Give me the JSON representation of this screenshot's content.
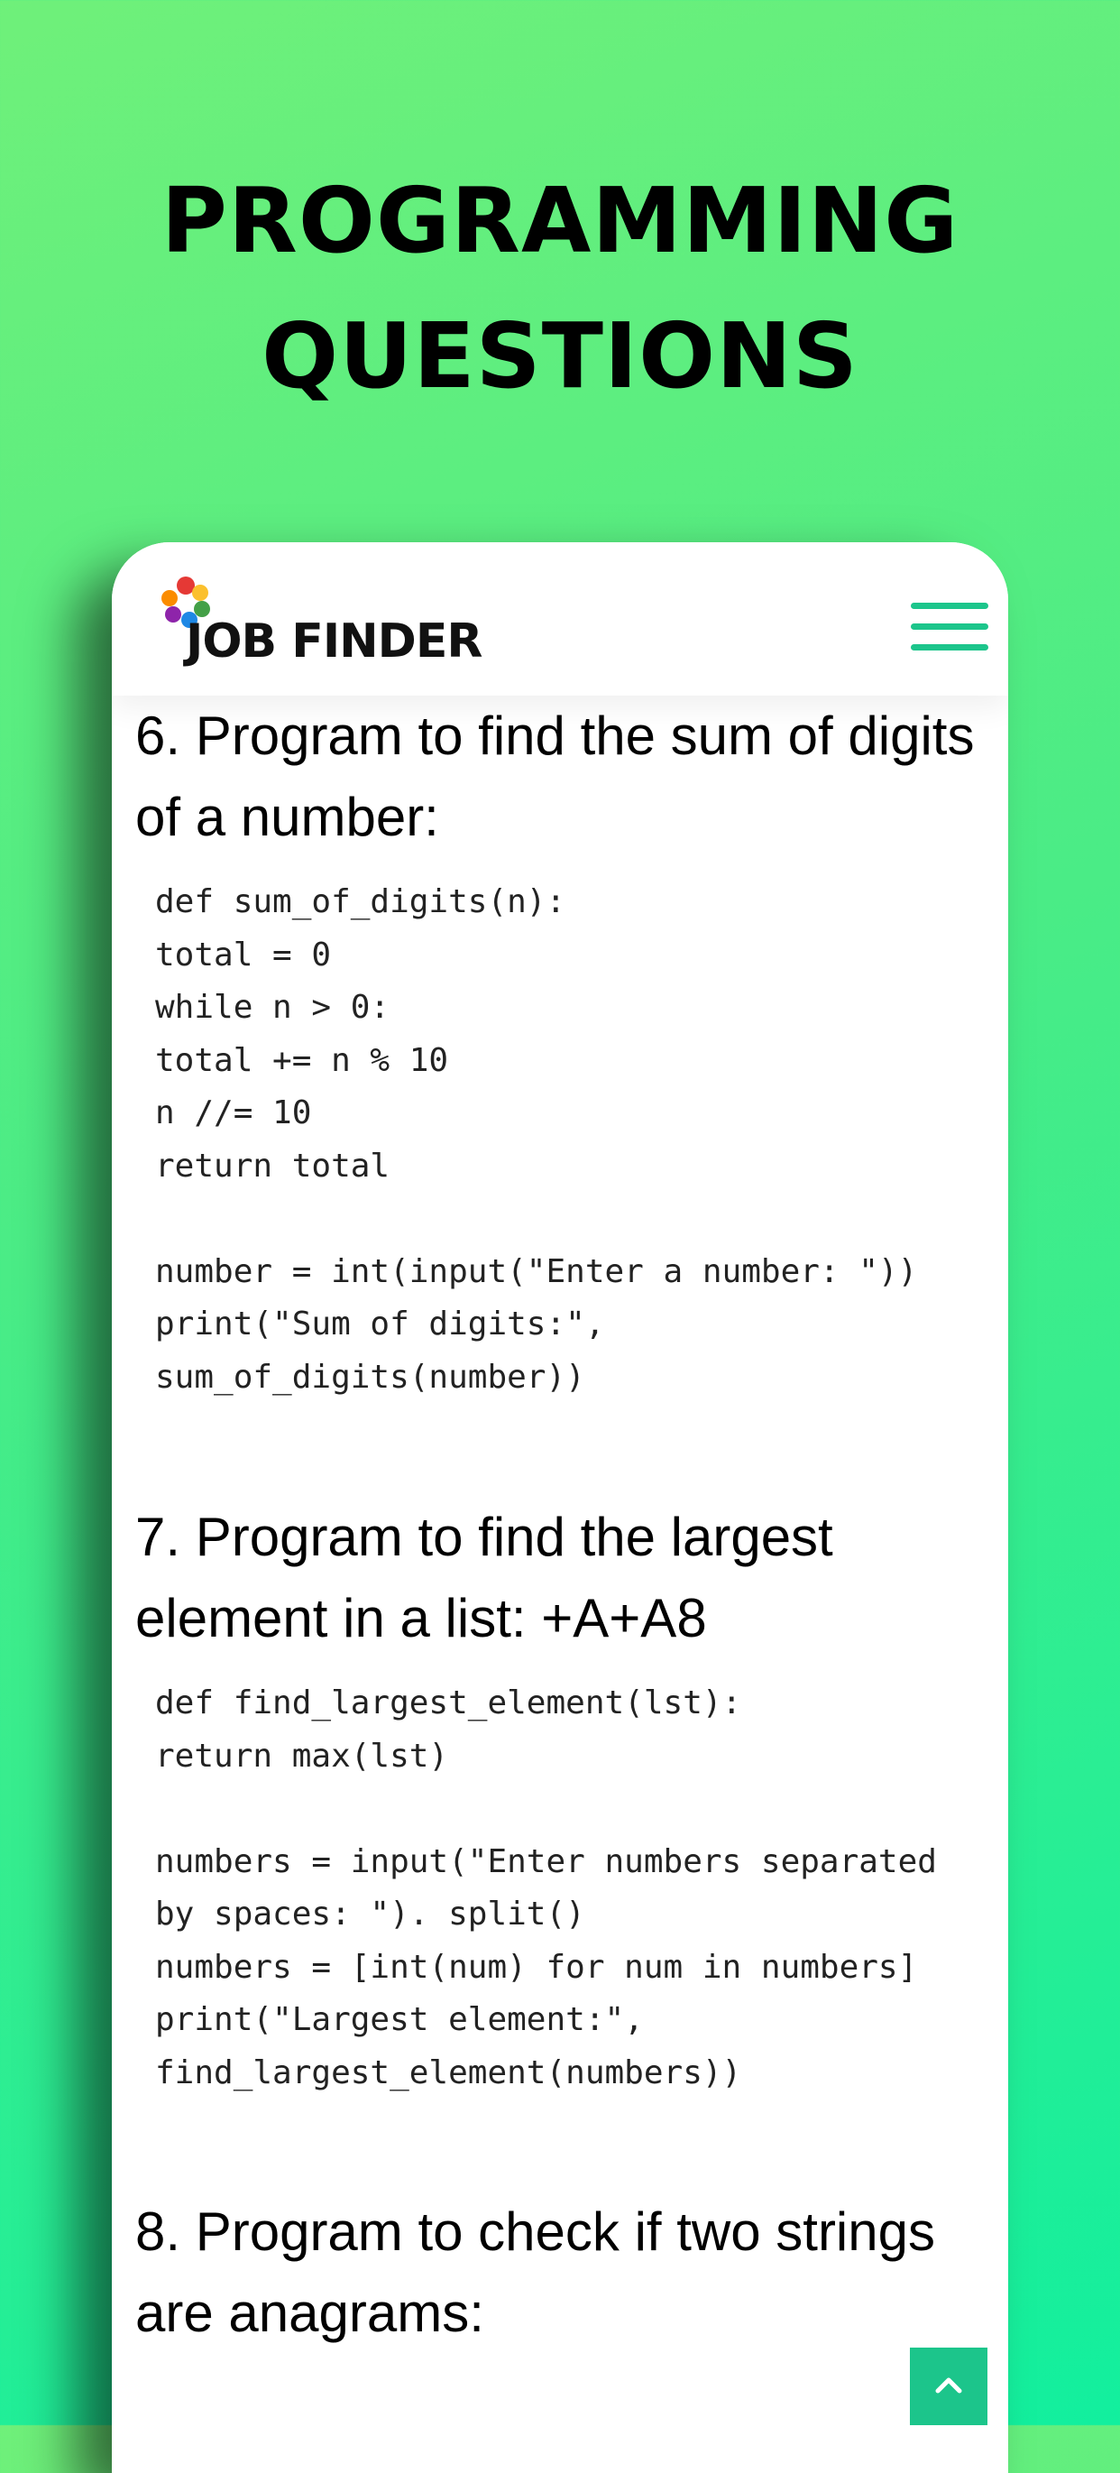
{
  "headline": [
    "PROGRAMMING",
    "QUESTIONS"
  ],
  "brand": {
    "name": "JOB FINDER"
  },
  "icons": {
    "menu": "hamburger-menu-icon",
    "back_to_top": "chevron-up-icon"
  },
  "colors": {
    "accent": "#1cc58b",
    "background_start": "#6ff07a",
    "background_end": "#12ef9e"
  },
  "sections": [
    {
      "title": "6. Program to find the sum of digits of a number:",
      "code": "def sum_of_digits(n):\ntotal = 0\nwhile n > 0:\ntotal += n % 10\nn //= 10\nreturn total\n\nnumber = int(input(\"Enter a number: \"))\nprint(\"Sum of digits:\",\nsum_of_digits(number))"
    },
    {
      "title": "7. Program to find the largest element in a list: +A+A8",
      "code": "def find_largest_element(lst):\nreturn max(lst)\n\nnumbers = input(\"Enter numbers separated by spaces: \"). split()\nnumbers = [int(num) for num in numbers]\nprint(\"Largest element:\",\nfind_largest_element(numbers))"
    },
    {
      "title": "8. Program to check if two strings are anagrams:",
      "code": ""
    }
  ]
}
